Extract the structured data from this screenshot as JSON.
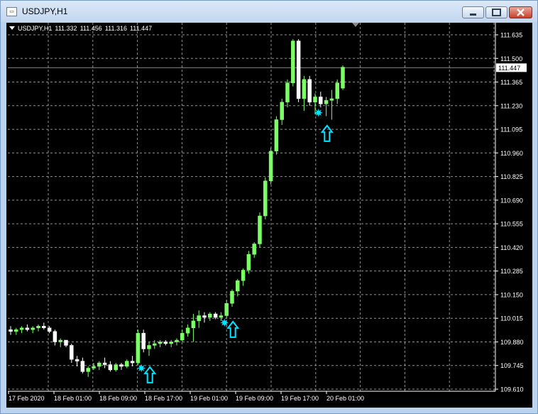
{
  "window": {
    "title": "USDJPY,H1",
    "icon": "chart-window-icon",
    "buttons": [
      "minimize-icon",
      "maximize-icon",
      "close-icon"
    ]
  },
  "chart_header": {
    "symbol_period": "USDJPY,H1",
    "open": "111.332",
    "high": "111.456",
    "low": "111.316",
    "close": "111.447"
  },
  "colors": {
    "background": "#000000",
    "grid": "#d0d0d0",
    "bull_candle": "#7cff66",
    "bear_candle": "#ffffff",
    "signal": "#00e5ff",
    "price_line": "#778899",
    "axis_text": "#ffffff"
  },
  "chart_data": {
    "type": "candlestick",
    "symbol": "USDJPY",
    "timeframe": "H1",
    "grid": true,
    "current_price": "111.447",
    "y_ticks": [
      "111.635",
      "111.500",
      "111.365",
      "111.230",
      "111.095",
      "110.960",
      "110.825",
      "110.690",
      "110.555",
      "110.420",
      "110.285",
      "110.150",
      "110.015",
      "109.880",
      "109.745",
      "109.610"
    ],
    "ylim": [
      109.61,
      111.635
    ],
    "x_ticks": [
      "17 Feb 2020",
      "18 Feb 01:00",
      "18 Feb 09:00",
      "18 Feb 17:00",
      "19 Feb 01:00",
      "19 Feb 09:00",
      "19 Feb 17:00",
      "20 Feb 01:00"
    ],
    "candles": [
      [
        109.95,
        109.97,
        109.92,
        109.94
      ],
      [
        109.94,
        109.96,
        109.92,
        109.95
      ],
      [
        109.95,
        109.97,
        109.93,
        109.96
      ],
      [
        109.96,
        109.98,
        109.94,
        109.95
      ],
      [
        109.95,
        109.97,
        109.93,
        109.96
      ],
      [
        109.96,
        109.98,
        109.94,
        109.97
      ],
      [
        109.97,
        109.99,
        109.95,
        109.96
      ],
      [
        109.96,
        109.97,
        109.93,
        109.94
      ],
      [
        109.94,
        109.95,
        109.86,
        109.88
      ],
      [
        109.88,
        109.9,
        109.85,
        109.89
      ],
      [
        109.89,
        109.89,
        109.85,
        109.86
      ],
      [
        109.86,
        109.87,
        109.76,
        109.78
      ],
      [
        109.78,
        109.8,
        109.74,
        109.77
      ],
      [
        109.77,
        109.79,
        109.7,
        109.71
      ],
      [
        109.71,
        109.74,
        109.68,
        109.73
      ],
      [
        109.73,
        109.76,
        109.72,
        109.74
      ],
      [
        109.74,
        109.77,
        109.72,
        109.76
      ],
      [
        109.76,
        109.79,
        109.73,
        109.75
      ],
      [
        109.75,
        109.77,
        109.71,
        109.72
      ],
      [
        109.72,
        109.76,
        109.71,
        109.75
      ],
      [
        109.75,
        109.76,
        109.72,
        109.74
      ],
      [
        109.74,
        109.78,
        109.73,
        109.77
      ],
      [
        109.77,
        109.8,
        109.74,
        109.76
      ],
      [
        109.76,
        109.95,
        109.75,
        109.93
      ],
      [
        109.93,
        109.95,
        109.82,
        109.84
      ],
      [
        109.84,
        109.88,
        109.8,
        109.86
      ],
      [
        109.86,
        109.89,
        109.84,
        109.87
      ],
      [
        109.87,
        109.89,
        109.85,
        109.88
      ],
      [
        109.88,
        109.89,
        109.86,
        109.87
      ],
      [
        109.87,
        109.89,
        109.85,
        109.88
      ],
      [
        109.88,
        109.9,
        109.86,
        109.89
      ],
      [
        109.89,
        109.95,
        109.88,
        109.93
      ],
      [
        109.93,
        109.98,
        109.91,
        109.96
      ],
      [
        109.96,
        110.04,
        109.88,
        110.0
      ],
      [
        110.0,
        110.06,
        109.96,
        110.03
      ],
      [
        110.03,
        110.05,
        109.99,
        110.02
      ],
      [
        110.02,
        110.05,
        110.0,
        110.04
      ],
      [
        110.04,
        110.05,
        110.01,
        110.02
      ],
      [
        110.02,
        110.05,
        110.0,
        110.03
      ],
      [
        110.03,
        110.12,
        110.02,
        110.1
      ],
      [
        110.1,
        110.18,
        110.08,
        110.17
      ],
      [
        110.17,
        110.24,
        110.14,
        110.23
      ],
      [
        110.23,
        110.3,
        110.2,
        110.29
      ],
      [
        110.29,
        110.4,
        110.27,
        110.38
      ],
      [
        110.38,
        110.45,
        110.36,
        110.44
      ],
      [
        110.44,
        110.62,
        110.42,
        110.6
      ],
      [
        110.6,
        110.82,
        110.58,
        110.8
      ],
      [
        110.8,
        110.99,
        110.78,
        110.97
      ],
      [
        110.97,
        111.17,
        110.95,
        111.15
      ],
      [
        111.15,
        111.27,
        111.12,
        111.25
      ],
      [
        111.25,
        111.38,
        111.22,
        111.36
      ],
      [
        111.36,
        111.61,
        111.34,
        111.6
      ],
      [
        111.6,
        111.61,
        111.25,
        111.27
      ],
      [
        111.27,
        111.4,
        111.2,
        111.38
      ],
      [
        111.38,
        111.4,
        111.23,
        111.25
      ],
      [
        111.25,
        111.3,
        111.18,
        111.28
      ],
      [
        111.28,
        111.31,
        111.22,
        111.24
      ],
      [
        111.24,
        111.28,
        111.17,
        111.26
      ],
      [
        111.26,
        111.32,
        111.15,
        111.27
      ],
      [
        111.27,
        111.38,
        111.24,
        111.36
      ],
      [
        111.33,
        111.46,
        111.32,
        111.45
      ]
    ],
    "signals": [
      {
        "candle": 24,
        "star_price": 109.73,
        "arrow_price": 109.72
      },
      {
        "candle": 39,
        "star_price": 109.99,
        "arrow_price": 109.98
      },
      {
        "candle": 56,
        "star_price": 111.19,
        "arrow_price": 111.1
      }
    ]
  }
}
